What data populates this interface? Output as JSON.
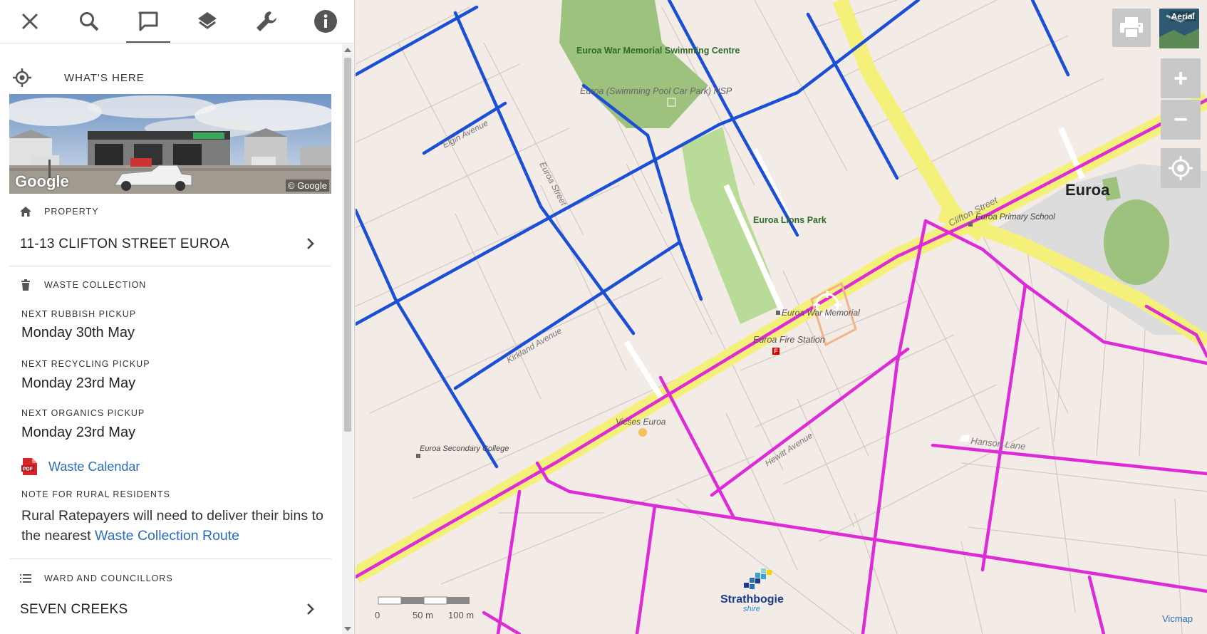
{
  "toolbar": {
    "items": [
      {
        "icon": "close-icon"
      },
      {
        "icon": "search-icon"
      },
      {
        "icon": "speech-bubble-icon"
      },
      {
        "icon": "layers-icon"
      },
      {
        "icon": "wrench-icon"
      },
      {
        "icon": "info-icon"
      }
    ],
    "active_index": 2
  },
  "whats_here": {
    "label": "WHAT'S HERE"
  },
  "photo": {
    "watermark_left": "Google",
    "watermark_right": "© Google"
  },
  "property": {
    "header": "PROPERTY",
    "address": "11-13 CLIFTON STREET EUROA"
  },
  "waste": {
    "header": "WASTE COLLECTION",
    "rubbish_label": "NEXT RUBBISH PICKUP",
    "rubbish_value": "Monday 30th May",
    "recycling_label": "NEXT RECYCLING PICKUP",
    "recycling_value": "Monday 23rd May",
    "organics_label": "NEXT ORGANICS PICKUP",
    "organics_value": "Monday 23rd May",
    "calendar_link": "Waste Calendar",
    "note_label": "NOTE FOR RURAL RESIDENTS",
    "note_text": "Rural Ratepayers will need to deliver their bins to the nearest ",
    "note_link": "Waste Collection Route"
  },
  "ward": {
    "header": "WARD AND COUNCILLORS",
    "value": "SEVEN CREEKS"
  },
  "map": {
    "labels": {
      "swimming_centre": "Euroa War Memorial Swimming Centre",
      "car_park": "Euroa (Swimming Pool Car Park) NSP",
      "lions_park": "Euroa Lions Park",
      "euroa": "Euroa",
      "primary_school": "Euroa Primary School",
      "war_memorial": "Euroa War Memorial",
      "fire_station": "Euroa Fire Station",
      "vicses": "Vicses Euroa",
      "secondary_college": "Euroa Secondary College",
      "clifton_street": "Clifton Street",
      "elgin_avenue": "Elgin Avenue",
      "kirkland_avenue": "Kirkland Avenue",
      "hewitt_avenue": "Hewitt Avenue",
      "hanson_lane": "Hanson Lane",
      "euroa_street": "Euroa Street",
      "vicmap": "Vicmap"
    },
    "brand_line1": "Strathbogie",
    "brand_line2": "shire",
    "scale": {
      "t0": "0",
      "t1": "50 m",
      "t2": "100 m"
    },
    "buttons": {
      "aerial": "Aerial",
      "zoom_in": "+",
      "zoom_out": "−"
    },
    "colors": {
      "blue_route": "#1a4fd6",
      "magenta_route": "#dd2bd6",
      "highway": "#f5f07a",
      "park": "#9cc27e",
      "school": "#dcdcdc"
    }
  }
}
